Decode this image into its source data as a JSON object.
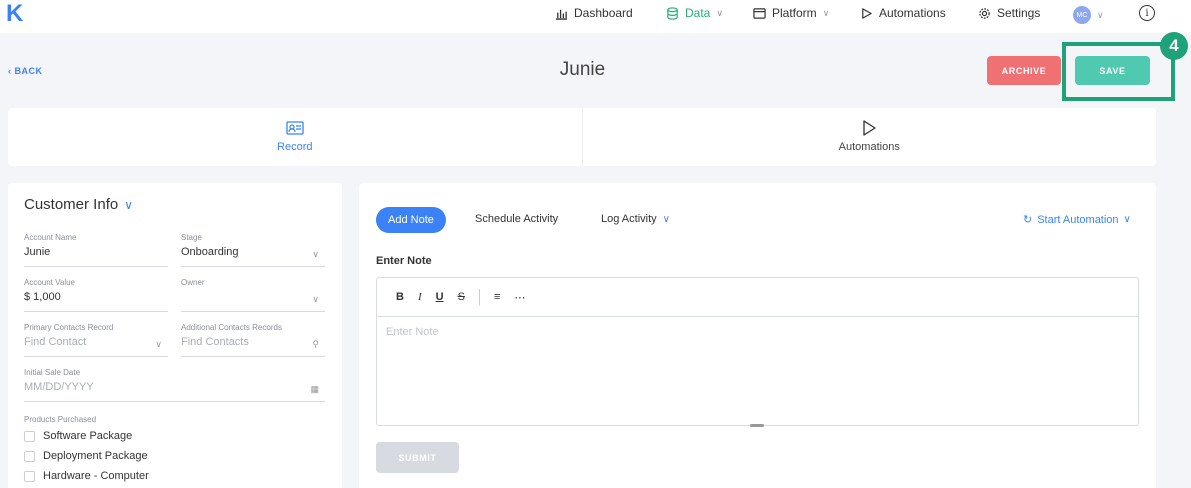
{
  "app": {
    "logo": "K"
  },
  "nav": {
    "dashboard": "Dashboard",
    "data": "Data",
    "platform": "Platform",
    "automations": "Automations",
    "settings": "Settings",
    "avatar_initials": "MC",
    "info_glyph": "i"
  },
  "header": {
    "back_label": "BACK",
    "title": "Junie",
    "archive_label": "ARCHIVE",
    "save_label": "SAVE",
    "step_badge": "4"
  },
  "tabs": [
    {
      "label": "Record",
      "icon": "contact-card-icon",
      "active": true
    },
    {
      "label": "Automations",
      "icon": "play-icon",
      "active": false
    }
  ],
  "customer_info": {
    "title": "Customer Info",
    "account_name": {
      "label": "Account Name",
      "value": "Junie"
    },
    "stage": {
      "label": "Stage",
      "value": "Onboarding"
    },
    "account_value": {
      "label": "Account Value",
      "value": "$ 1,000"
    },
    "owner": {
      "label": "Owner",
      "value": ""
    },
    "primary_contacts": {
      "label": "Primary Contacts Record",
      "placeholder": "Find Contact"
    },
    "additional_contacts": {
      "label": "Additional Contacts Records",
      "placeholder": "Find Contacts"
    },
    "initial_sale_date": {
      "label": "Initial Sale Date",
      "placeholder": "MM/DD/YYYY"
    },
    "products": {
      "label": "Products Purchased",
      "items": [
        "Software Package",
        "Deployment Package",
        "Hardware - Computer"
      ]
    }
  },
  "activity": {
    "add_note": "Add Note",
    "schedule_activity": "Schedule Activity",
    "log_activity": "Log Activity",
    "start_automation": "Start Automation",
    "enter_note_label": "Enter Note",
    "editor_placeholder": "Enter Note",
    "toolbar": {
      "bold": "B",
      "italic": "I",
      "underline": "U",
      "strike": "S"
    },
    "submit_label": "SUBMIT"
  },
  "colors": {
    "accent": "#3b82f6",
    "data_active": "#27ae7a",
    "archive": "#f07174",
    "save": "#4fc9b0",
    "highlight": "#1ea27a"
  }
}
